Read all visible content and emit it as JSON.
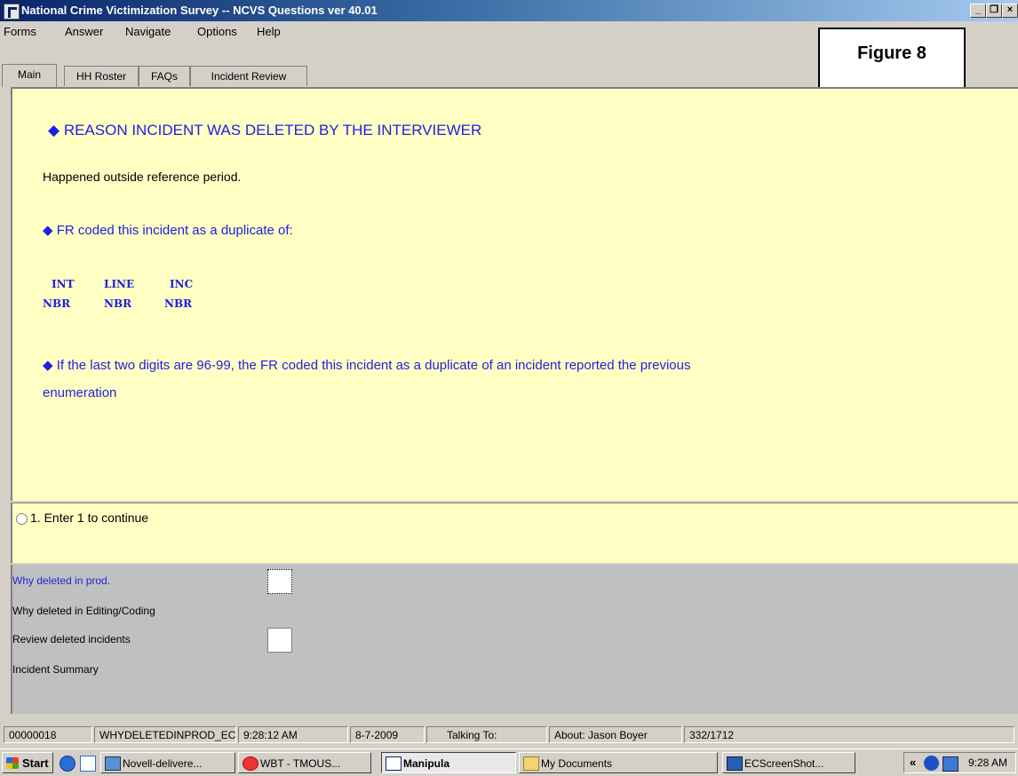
{
  "window": {
    "title": "National Crime Victimization Survey -- NCVS Questions ver 40.01",
    "controls": [
      "_",
      "❐",
      "×"
    ]
  },
  "menu": [
    "Forms",
    "Answer",
    "Navigate",
    "Options",
    "Help"
  ],
  "figure_label": "Figure 8",
  "tabs": [
    "Main",
    "HH Roster",
    "FAQs",
    "Incident Review"
  ],
  "question": {
    "heading": "REASON INCIDENT WAS DELETED BY THE INTERVIEWER",
    "reason": "Happened outside reference period.",
    "duplicate_heading": "FR coded this incident as a duplicate of:",
    "columns": [
      {
        "top": "INT",
        "bottom": "NBR"
      },
      {
        "top": "LINE",
        "bottom": "NBR"
      },
      {
        "top": "INC",
        "bottom": "NBR"
      }
    ],
    "note_line1": "If the last two digits are 96-99, the FR coded this incident as a duplicate of an incident reported the previous",
    "note_line2": "enumeration"
  },
  "answer_option": "1. Enter 1 to continue",
  "fields": [
    {
      "label": "Why deleted in prod.",
      "has_box": true,
      "active": true
    },
    {
      "label": "Why deleted in Editing/Coding",
      "has_box": false,
      "active": false
    },
    {
      "label": "Review deleted incidents",
      "has_box": true,
      "active": false
    },
    {
      "label": "Incident Summary",
      "has_box": false,
      "active": false
    }
  ],
  "status": {
    "case_id": "00000018",
    "field": "WHYDELETEDINPROD_EC",
    "time": "9:28:12 AM",
    "date": "8-7-2009",
    "talking_to": "Talking To:",
    "about": "About:  Jason Boyer",
    "count": "332/1712"
  },
  "taskbar": {
    "start": "Start",
    "buttons": [
      "Novell-delivere...",
      "WBT - TMOUS...",
      "Manipula",
      "My Documents",
      "ECScreenShot..."
    ],
    "tray_chevron": "«",
    "clock": "9:28 AM"
  }
}
